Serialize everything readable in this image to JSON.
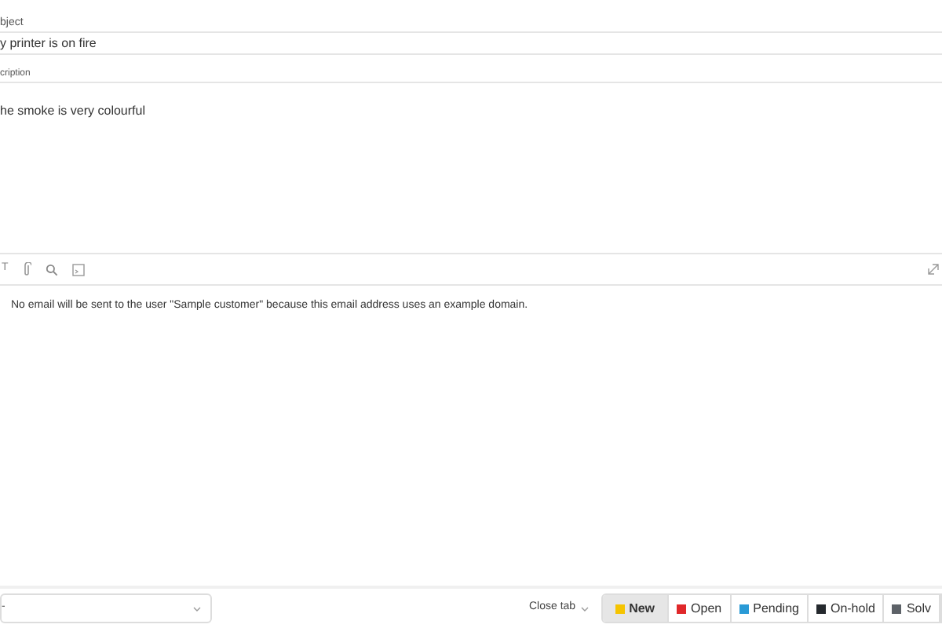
{
  "subject": {
    "label": "bject",
    "value": "y printer is on fire"
  },
  "description": {
    "label": "cription",
    "value": "he smoke is very colourful"
  },
  "toolbar": {
    "text_button": "T"
  },
  "notice": "No email will be sent to the user \"Sample customer\" because this email address uses an example domain.",
  "footer": {
    "select_value": "-",
    "close_tab": "Close tab",
    "states": [
      {
        "label": "New",
        "color": "#f5c400",
        "selected": true
      },
      {
        "label": "Open",
        "color": "#e0282a",
        "selected": false
      },
      {
        "label": "Pending",
        "color": "#2a9ad6",
        "selected": false
      },
      {
        "label": "On-hold",
        "color": "#25292e",
        "selected": false
      },
      {
        "label": "Solv",
        "color": "#5d6268",
        "selected": false
      }
    ]
  }
}
